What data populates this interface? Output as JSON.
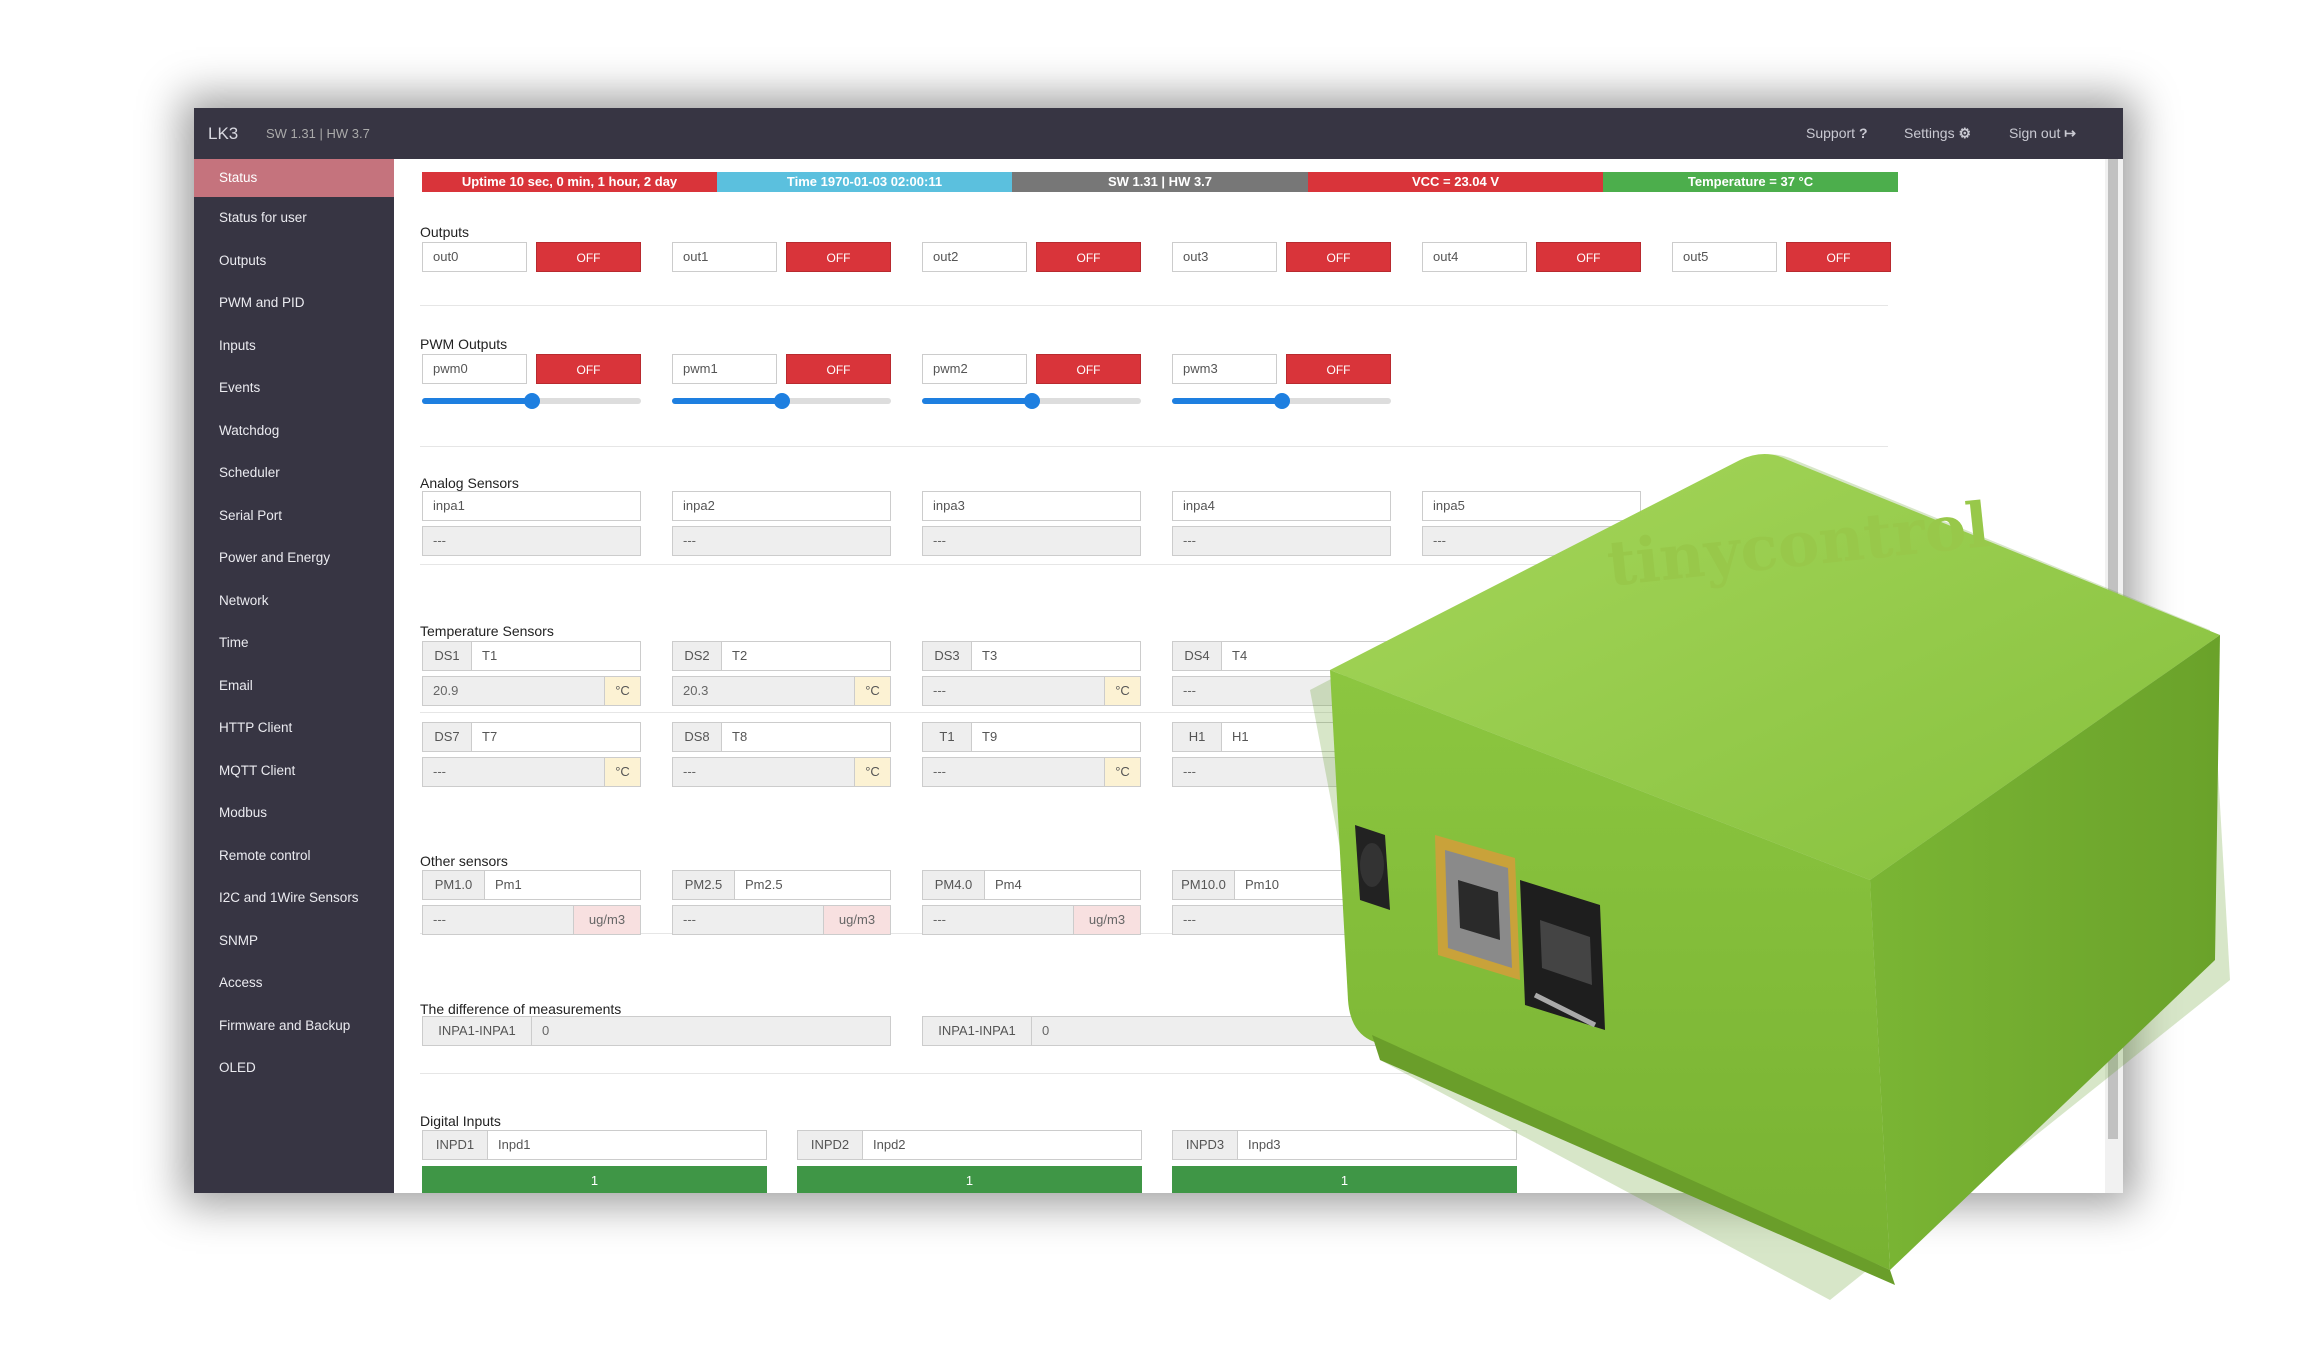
{
  "header": {
    "brand": "LK3",
    "version": "SW 1.31 | HW 3.7",
    "support": "Support",
    "settings": "Settings",
    "signout": "Sign out"
  },
  "sidebar": [
    "Status",
    "Status for user",
    "Outputs",
    "PWM and PID",
    "Inputs",
    "Events",
    "Watchdog",
    "Scheduler",
    "Serial Port",
    "Power and Energy",
    "Network",
    "Time",
    "Email",
    "HTTP Client",
    "MQTT Client",
    "Modbus",
    "Remote control",
    "I2C and 1Wire Sensors",
    "SNMP",
    "Access",
    "Firmware and Backup",
    "OLED"
  ],
  "badges": [
    {
      "text": "Uptime 10 sec, 0 min, 1 hour, 2 day",
      "color": "#d9343a"
    },
    {
      "text": "Time 1970-01-03 02:00:11",
      "color": "#5bc0de"
    },
    {
      "text": "SW 1.31 | HW 3.7",
      "color": "#777777"
    },
    {
      "text": "VCC = 23.04 V",
      "color": "#d9343a"
    },
    {
      "text": "Temperature = 37 °C",
      "color": "#4cae4c"
    }
  ],
  "sections": {
    "outputs": "Outputs",
    "pwm": "PWM Outputs",
    "analog": "Analog Sensors",
    "temp": "Temperature Sensors",
    "other": "Other sensors",
    "diff": "The difference of measurements",
    "digital": "Digital Inputs"
  },
  "outputs": [
    {
      "name": "out0",
      "state": "OFF"
    },
    {
      "name": "out1",
      "state": "OFF"
    },
    {
      "name": "out2",
      "state": "OFF"
    },
    {
      "name": "out3",
      "state": "OFF"
    },
    {
      "name": "out4",
      "state": "OFF"
    },
    {
      "name": "out5",
      "state": "OFF"
    }
  ],
  "pwm": [
    {
      "name": "pwm0",
      "state": "OFF",
      "level": 0.5
    },
    {
      "name": "pwm1",
      "state": "OFF",
      "level": 0.5
    },
    {
      "name": "pwm2",
      "state": "OFF",
      "level": 0.5
    },
    {
      "name": "pwm3",
      "state": "OFF",
      "level": 0.5
    }
  ],
  "analog": [
    {
      "name": "inpa1",
      "value": "---"
    },
    {
      "name": "inpa2",
      "value": "---"
    },
    {
      "name": "inpa3",
      "value": "---"
    },
    {
      "name": "inpa4",
      "value": "---"
    },
    {
      "name": "inpa5",
      "value": "---"
    }
  ],
  "temp_row1": [
    {
      "id": "DS1",
      "name": "T1",
      "value": "20.9",
      "unit": "°C"
    },
    {
      "id": "DS2",
      "name": "T2",
      "value": "20.3",
      "unit": "°C"
    },
    {
      "id": "DS3",
      "name": "T3",
      "value": "---",
      "unit": "°C"
    },
    {
      "id": "DS4",
      "name": "T4",
      "value": "---",
      "unit": ""
    }
  ],
  "temp_row2": [
    {
      "id": "DS7",
      "name": "T7",
      "value": "---",
      "unit": "°C"
    },
    {
      "id": "DS8",
      "name": "T8",
      "value": "---",
      "unit": "°C"
    },
    {
      "id": "T1",
      "name": "T9",
      "value": "---",
      "unit": "°C"
    },
    {
      "id": "H1",
      "name": "H1",
      "value": "---",
      "unit": ""
    }
  ],
  "other": [
    {
      "id": "PM1.0",
      "name": "Pm1",
      "value": "---",
      "unit": "ug/m3"
    },
    {
      "id": "PM2.5",
      "name": "Pm2.5",
      "value": "---",
      "unit": "ug/m3"
    },
    {
      "id": "PM4.0",
      "name": "Pm4",
      "value": "---",
      "unit": "ug/m3"
    },
    {
      "id": "PM10.0",
      "name": "Pm10",
      "value": "---",
      "unit": ""
    }
  ],
  "diff": [
    {
      "id": "INPA1-INPA1",
      "value": "0"
    },
    {
      "id": "INPA1-INPA1",
      "value": "0"
    }
  ],
  "digital": [
    {
      "id": "INPD1",
      "name": "Inpd1",
      "state": "1"
    },
    {
      "id": "INPD2",
      "name": "Inpd2",
      "state": "1"
    },
    {
      "id": "INPD3",
      "name": "Inpd3",
      "state": "1"
    }
  ],
  "device": {
    "logo": "tinycontrol",
    "body_color": "#8cc63f"
  }
}
